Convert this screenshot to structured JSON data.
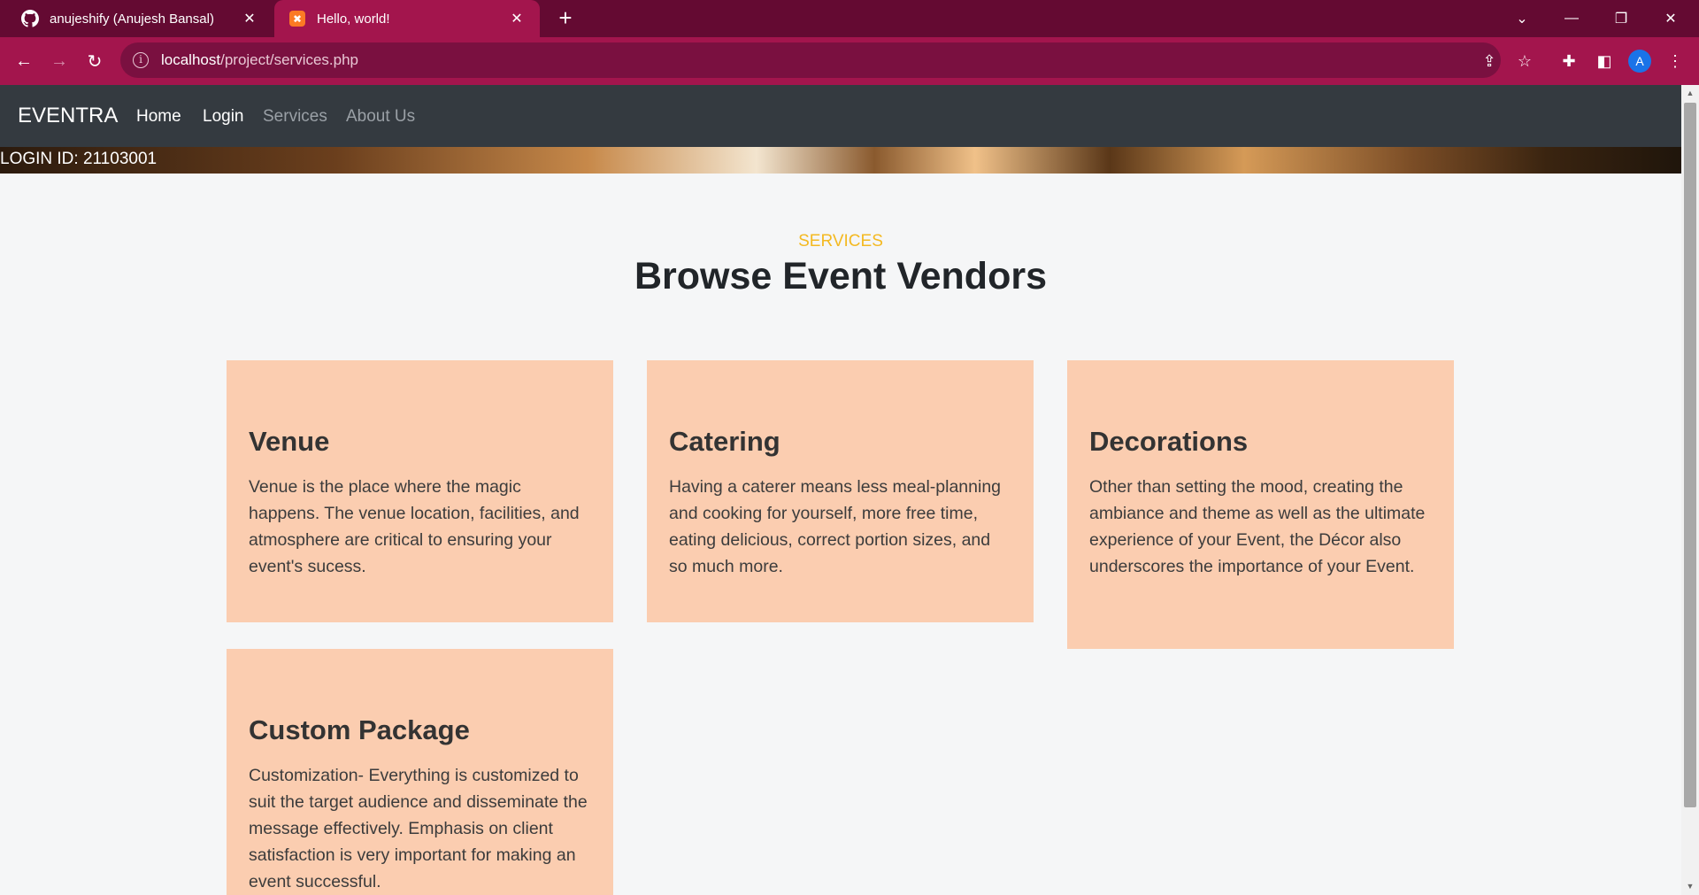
{
  "browser": {
    "tabs": [
      {
        "title": "anujeshify (Anujesh Bansal)",
        "icon": "github-icon",
        "active": false
      },
      {
        "title": "Hello, world!",
        "icon": "xampp-icon",
        "active": true
      }
    ],
    "url_host": "localhost",
    "url_path": "/project/services.php",
    "profile_initial": "A",
    "colors": {
      "frame": "#640a32",
      "active": "#a3154d"
    }
  },
  "navbar": {
    "brand": "EVENTRA",
    "links": [
      {
        "label": "Home"
      },
      {
        "label": "Login"
      },
      {
        "label": "Services"
      },
      {
        "label": "About Us"
      }
    ]
  },
  "banner": {
    "login_id": "LOGIN ID: 21103001"
  },
  "section": {
    "eyebrow": "SERVICES",
    "title": "Browse Event Vendors"
  },
  "cards": [
    {
      "title": "Venue",
      "text": "Venue is the place where the magic happens. The venue location, facilities, and atmosphere are critical to ensuring your event's sucess."
    },
    {
      "title": "Catering",
      "text": "Having a caterer means less meal-planning and cooking for yourself, more free time, eating delicious, correct portion sizes, and so much more."
    },
    {
      "title": "Decorations",
      "text": "Other than setting the mood, creating the ambiance and theme as well as the ultimate experience of your Event, the Décor also underscores the importance of your Event."
    },
    {
      "title": "Custom Package",
      "text": "Customization- Everything is customized to suit the target audience and disseminate the message effectively. Emphasis on client satisfaction is very important for making an event successful."
    }
  ],
  "theme": {
    "card_bg": "#fbcdb0",
    "accent": "#f4b921",
    "navbar_bg": "#343a40"
  }
}
